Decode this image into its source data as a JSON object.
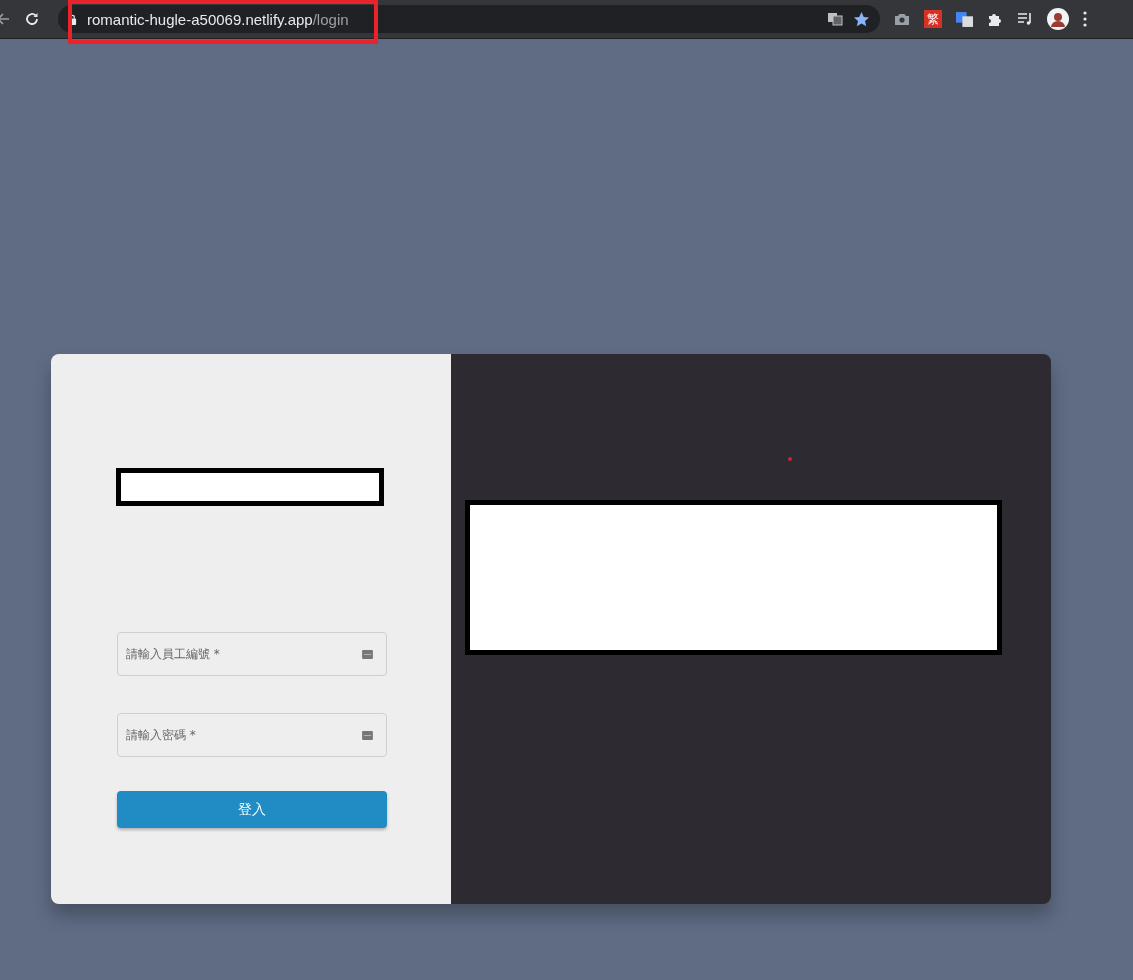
{
  "browser": {
    "url_host": "romantic-hugle-a50069.netlify.app",
    "url_path": "/login",
    "extension_badge": "繁"
  },
  "login": {
    "fields": [
      {
        "placeholder": "請輸入員工編號 *"
      },
      {
        "placeholder": "請輸入密碼 *"
      }
    ],
    "submit": "登入"
  }
}
